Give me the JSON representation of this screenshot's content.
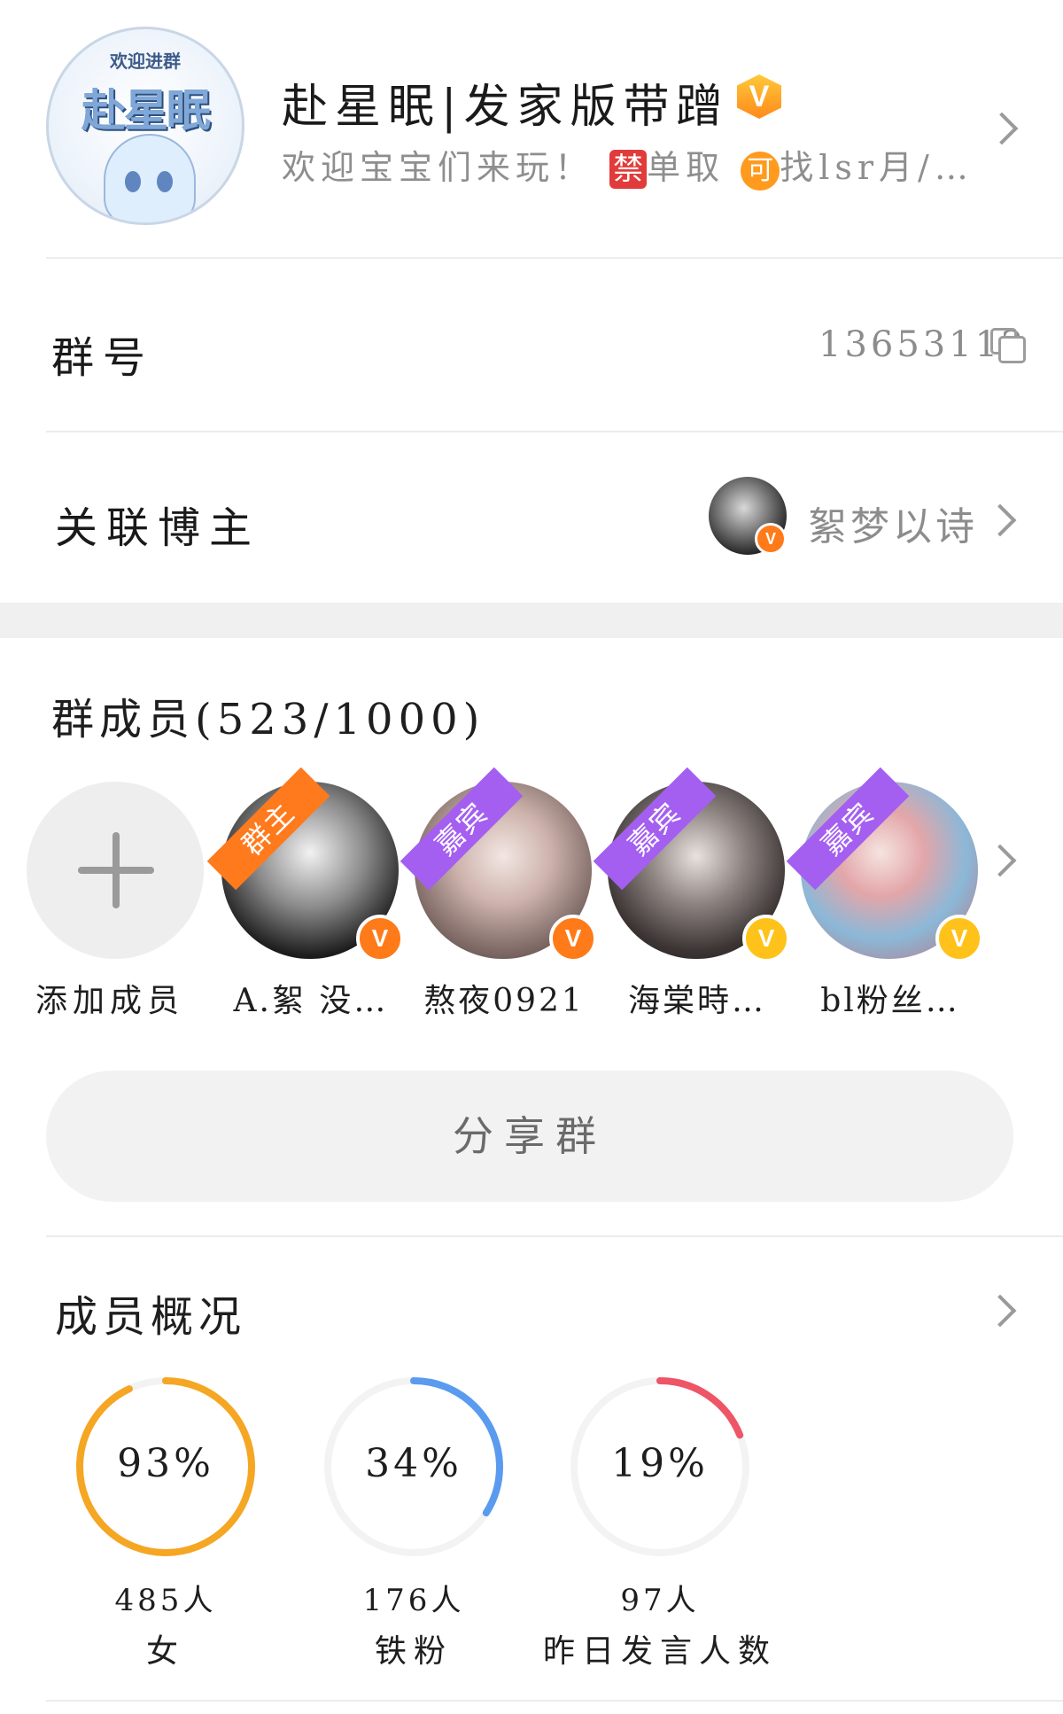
{
  "group": {
    "avatar_top_text": "欢迎进群",
    "avatar_main_text": "赴星眠",
    "title": "赴星眠|发家版带蹭",
    "desc_prefix": "欢迎宝宝们来玩！",
    "tag_forbid": "禁",
    "desc_mid": "单取",
    "tag_allow": "可",
    "desc_suffix": "找lsr月/…",
    "verified_badge": "V"
  },
  "group_number": {
    "label": "群号",
    "value": "13653112",
    "copy_icon": "copy-icon"
  },
  "linked_blogger": {
    "label": "关联博主",
    "name": "絮梦以诗",
    "badge": "V"
  },
  "members": {
    "title": "群成员(523/1000)",
    "add_label": "添加成员",
    "list": [
      {
        "name": "A.絮 没…",
        "role": "群主",
        "role_color": "#ff7a1c",
        "badge": "V",
        "badge_color": "#ff7a18"
      },
      {
        "name": "熬夜0921",
        "role": "嘉宾",
        "role_color": "#a45ff0",
        "badge": "V",
        "badge_color": "#ff7a18"
      },
      {
        "name": "海棠時…",
        "role": "嘉宾",
        "role_color": "#a45ff0",
        "badge": "V",
        "badge_color": "#ffc21a"
      },
      {
        "name": "bl粉丝…",
        "role": "嘉宾",
        "role_color": "#a45ff0",
        "badge": "V",
        "badge_color": "#ffc21a"
      }
    ]
  },
  "share_button": "分享群",
  "overview": {
    "title": "成员概况",
    "stats": [
      {
        "percent": "93%",
        "value": 93,
        "count": "485人",
        "label": "女",
        "color": "#f5a623"
      },
      {
        "percent": "34%",
        "value": 34,
        "count": "176人",
        "label": "铁粉",
        "color": "#5a9bf0"
      },
      {
        "percent": "19%",
        "value": 19,
        "count": "97人",
        "label": "昨日发言人数",
        "color": "#ee5566"
      }
    ]
  }
}
